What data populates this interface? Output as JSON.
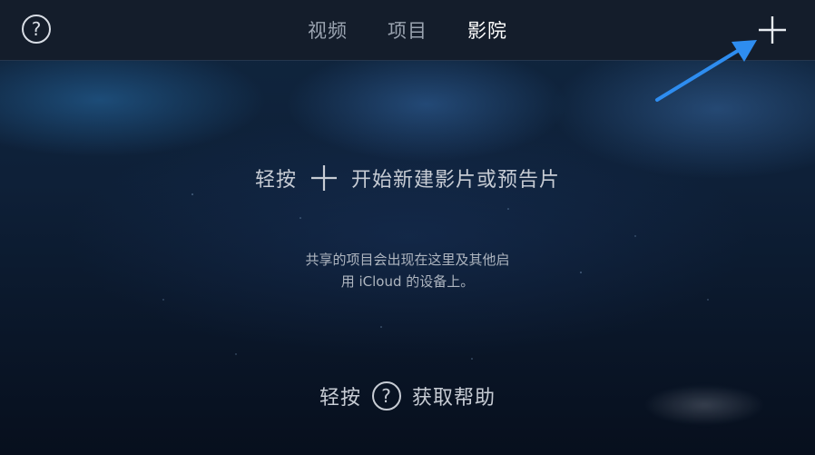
{
  "topbar": {
    "help_icon": "question-circle-icon",
    "help_symbol": "?",
    "tabs": [
      {
        "label": "视频",
        "active": false
      },
      {
        "label": "项目",
        "active": false
      },
      {
        "label": "影院",
        "active": true
      }
    ],
    "add_icon": "plus-icon"
  },
  "main": {
    "instruction_prefix": "轻按",
    "instruction_suffix": "开始新建影片或预告片",
    "shared_note_line1": "共享的项目会出现在这里及其他启",
    "shared_note_line2": "用 iCloud 的设备上。",
    "help_prefix": "轻按",
    "help_symbol": "?",
    "help_suffix": "获取帮助"
  },
  "colors": {
    "accent_arrow": "#2e8df0",
    "active_tab": "#ffffff",
    "inactive_tab": "#9aa3b0"
  }
}
